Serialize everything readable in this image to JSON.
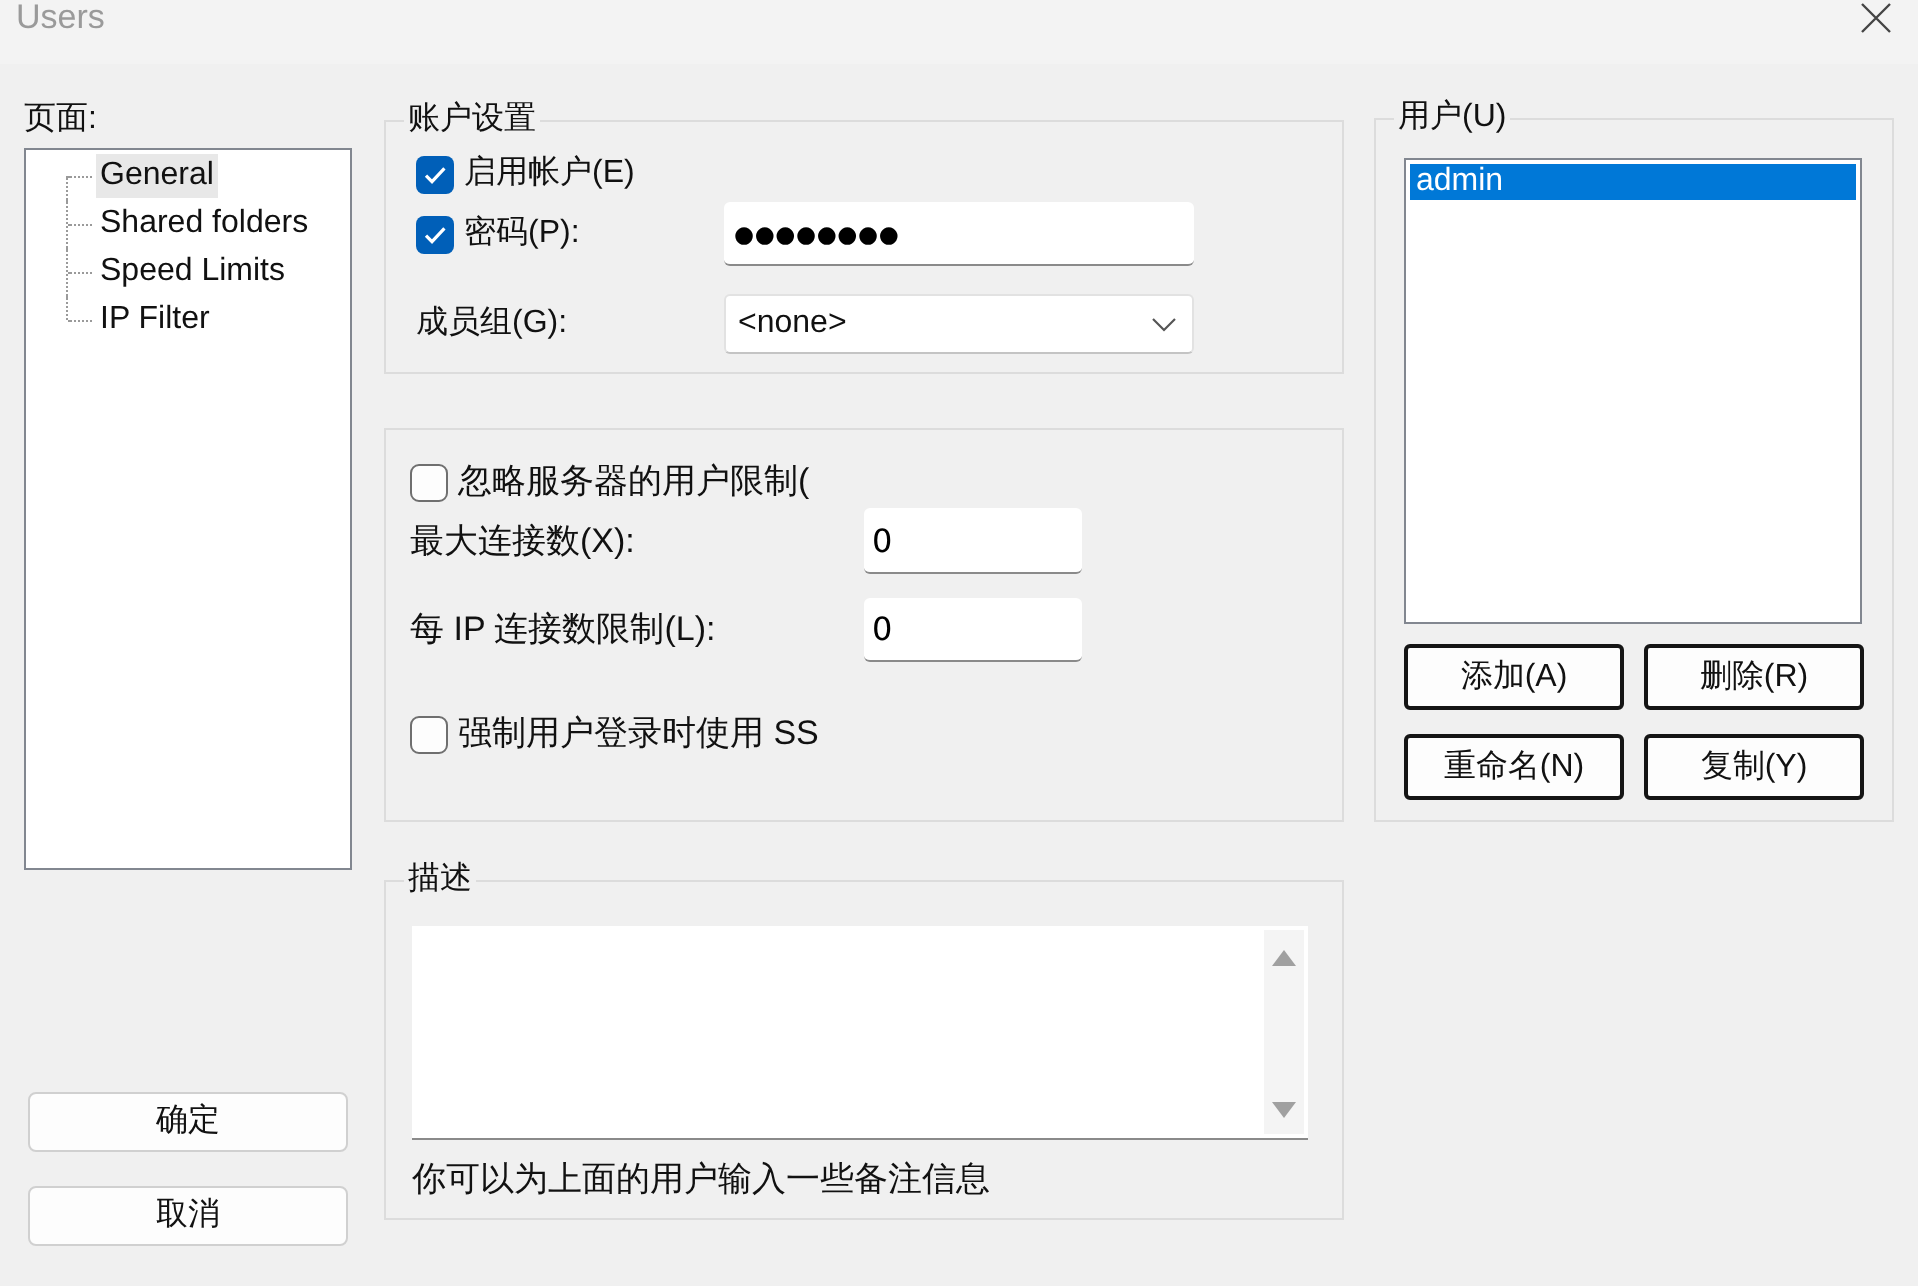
{
  "window": {
    "title": "Users"
  },
  "pages": {
    "label": "页面:",
    "items": [
      {
        "label": "General",
        "selected": true
      },
      {
        "label": "Shared folders",
        "selected": false
      },
      {
        "label": "Speed Limits",
        "selected": false
      },
      {
        "label": "IP Filter",
        "selected": false
      }
    ]
  },
  "account_settings": {
    "title": "账户设置",
    "enable_account": {
      "label": "启用帐户(E)",
      "checked": true
    },
    "password": {
      "label": "密码(P):",
      "checked": true,
      "value": "●●●●●●●●"
    },
    "group": {
      "label": "成员组(G):",
      "value": "<none>"
    }
  },
  "limits": {
    "ignore_server_limits": {
      "label": "忽略服务器的用户限制(",
      "checked": false
    },
    "max_connections": {
      "label": "最大连接数(X):",
      "value": "0"
    },
    "per_ip_limit": {
      "label": "每 IP 连接数限制(L):",
      "value": "0"
    },
    "force_ssl": {
      "label": "强制用户登录时使用 SS",
      "checked": false
    }
  },
  "description": {
    "title": "描述",
    "note": "你可以为上面的用户输入一些备注信息"
  },
  "users": {
    "title": "用户(U)",
    "items": [
      {
        "label": "admin",
        "selected": true
      }
    ],
    "buttons": [
      "添加(A)",
      "删除(R)",
      "重命名(N)",
      "复制(Y)"
    ]
  },
  "buttons": [
    "确定",
    "取消"
  ]
}
